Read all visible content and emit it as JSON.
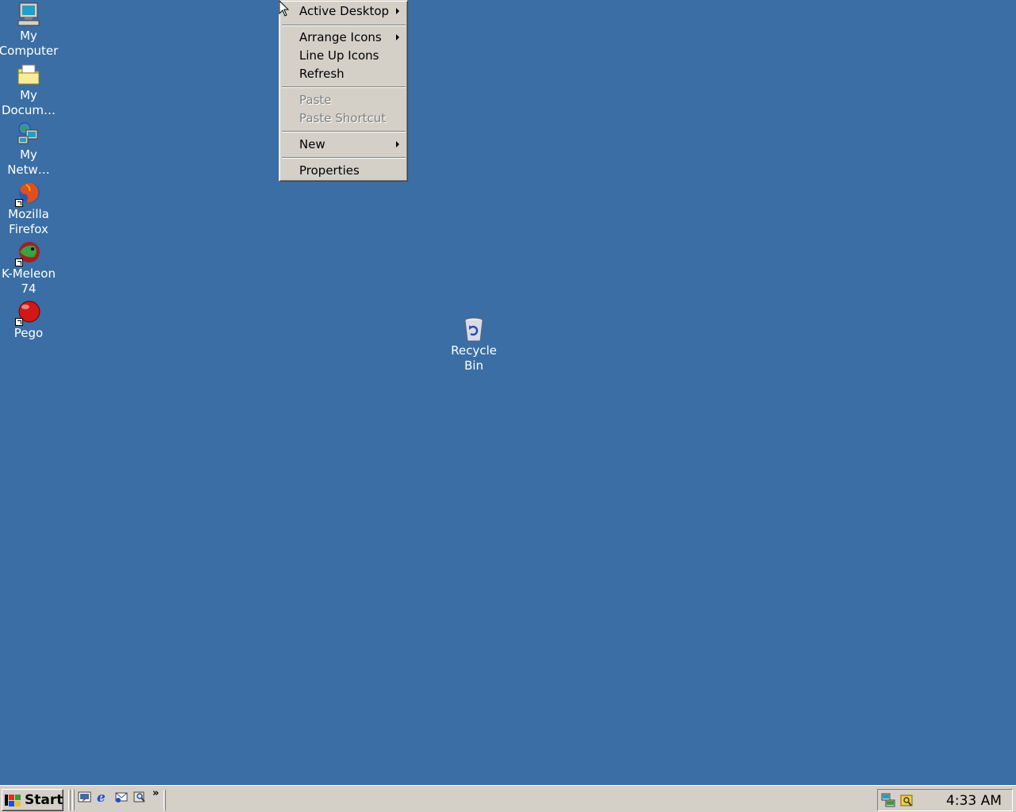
{
  "desktop": {
    "background_color": "#3a6ea5",
    "icons": [
      {
        "name": "My Computer",
        "line1": "My",
        "line2": "Computer",
        "icon": "computer-icon"
      },
      {
        "name": "My Documents",
        "line1": "My",
        "line2": "Docum…",
        "icon": "folder-icon"
      },
      {
        "name": "My Network Places",
        "line1": "My",
        "line2": "Netw…",
        "icon": "network-icon"
      },
      {
        "name": "Mozilla Firefox",
        "line1": "Mozilla",
        "line2": "Firefox",
        "icon": "firefox-icon"
      },
      {
        "name": "K-Meleon 74",
        "line1": "K-Meleon",
        "line2": "74",
        "icon": "kmeleon-icon"
      },
      {
        "name": "Pego",
        "line1": "Pego",
        "line2": "",
        "icon": "pego-icon"
      }
    ],
    "recycle_bin": {
      "line1": "Recycle",
      "line2": "Bin",
      "icon": "recycle-bin-icon"
    }
  },
  "context_menu": {
    "items": [
      {
        "label": "Active Desktop",
        "submenu": true,
        "enabled": true
      },
      {
        "label": "Arrange Icons",
        "submenu": true,
        "enabled": true
      },
      {
        "label": "Line Up Icons",
        "submenu": false,
        "enabled": true
      },
      {
        "label": "Refresh",
        "submenu": false,
        "enabled": true
      },
      {
        "label": "Paste",
        "submenu": false,
        "enabled": false
      },
      {
        "label": "Paste Shortcut",
        "submenu": false,
        "enabled": false
      },
      {
        "label": "New",
        "submenu": true,
        "enabled": true
      },
      {
        "label": "Properties",
        "submenu": false,
        "enabled": true
      }
    ]
  },
  "taskbar": {
    "start_label": "Start",
    "quick_launch": [
      "show-desktop-icon",
      "internet-explorer-icon",
      "outlook-express-icon",
      "media-icon"
    ],
    "overflow_label": "»",
    "tray_icons": [
      "network-tray-icon",
      "security-tray-icon"
    ],
    "clock": "4:33 AM"
  }
}
